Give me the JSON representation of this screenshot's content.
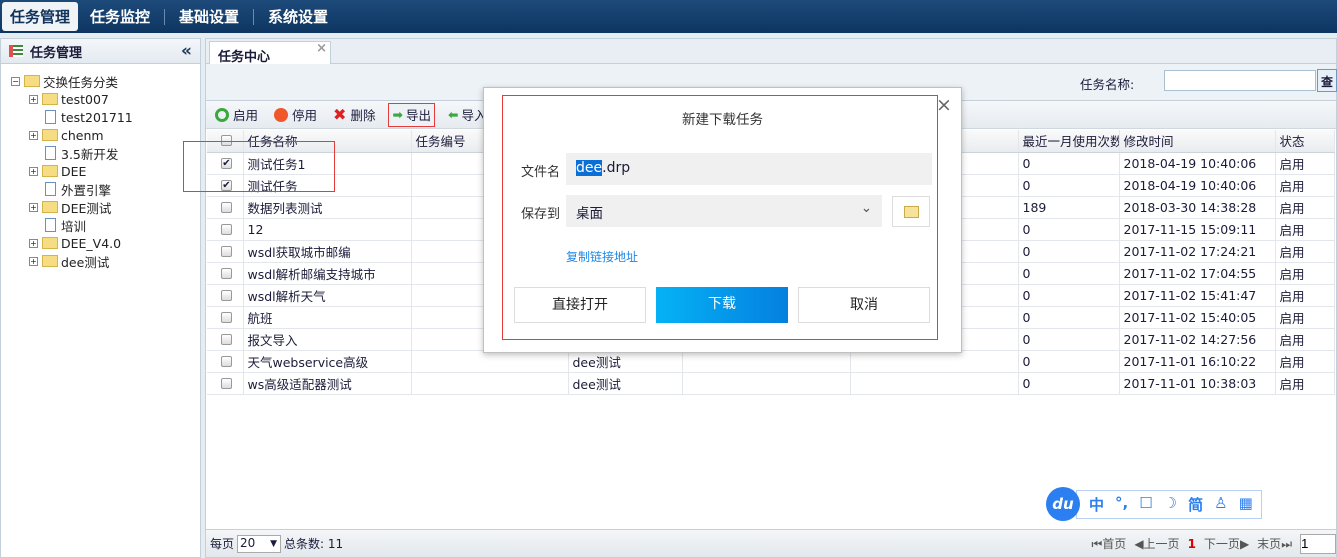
{
  "topnav": [
    "任务管理",
    "任务监控",
    "基础设置",
    "系统设置"
  ],
  "sidebar": {
    "title": "任务管理",
    "collapse": "«",
    "tree": [
      {
        "label": "交换任务分类",
        "type": "root"
      },
      {
        "label": "test007",
        "type": "folder"
      },
      {
        "label": "test201711",
        "type": "file"
      },
      {
        "label": "chenm",
        "type": "folder"
      },
      {
        "label": "3.5新开发",
        "type": "file"
      },
      {
        "label": "DEE",
        "type": "folder"
      },
      {
        "label": "外置引擎",
        "type": "file"
      },
      {
        "label": "DEE测试",
        "type": "folder"
      },
      {
        "label": "培训",
        "type": "file"
      },
      {
        "label": "DEE_V4.0",
        "type": "folder"
      },
      {
        "label": "dee测试",
        "type": "folder"
      }
    ]
  },
  "tab": {
    "label": "任务中心",
    "close": "×"
  },
  "search": {
    "label": "任务名称:",
    "value": "",
    "button": "查"
  },
  "toolbar": {
    "enable": "启用",
    "disable": "停用",
    "delete": "删除",
    "export": "导出",
    "import": "导入"
  },
  "table": {
    "headers": [
      "任务名称",
      "任务编号",
      "",
      "",
      "",
      "最近一月使用次数",
      "修改时间",
      "状态"
    ],
    "rows": [
      {
        "checked": true,
        "name": "测试任务1",
        "group": "",
        "count": "0",
        "time": "2018-04-19 10:40:06",
        "status": "启用"
      },
      {
        "checked": true,
        "name": "测试任务",
        "group": "",
        "count": "0",
        "time": "2018-04-19 10:40:06",
        "status": "启用"
      },
      {
        "checked": false,
        "name": "数据列表测试",
        "group": "",
        "count": "189",
        "time": "2018-03-30 14:38:28",
        "status": "启用"
      },
      {
        "checked": false,
        "name": "12",
        "group": "",
        "count": "0",
        "time": "2017-11-15 15:09:11",
        "status": "启用"
      },
      {
        "checked": false,
        "name": "wsdl获取城市邮编",
        "group": "",
        "count": "0",
        "time": "2017-11-02 17:24:21",
        "status": "启用"
      },
      {
        "checked": false,
        "name": "wsdl解析邮编支持城市",
        "group": "",
        "count": "0",
        "time": "2017-11-02 17:04:55",
        "status": "启用"
      },
      {
        "checked": false,
        "name": "wsdl解析天气",
        "group": "",
        "count": "0",
        "time": "2017-11-02 15:41:47",
        "status": "启用"
      },
      {
        "checked": false,
        "name": "航班",
        "group": "",
        "count": "0",
        "time": "2017-11-02 15:40:05",
        "status": "启用"
      },
      {
        "checked": false,
        "name": "报文导入",
        "group": "",
        "count": "0",
        "time": "2017-11-02 14:27:56",
        "status": "启用"
      },
      {
        "checked": false,
        "name": "天气webservice高级",
        "group": "dee测试",
        "count": "0",
        "time": "2017-11-01 16:10:22",
        "status": "启用"
      },
      {
        "checked": false,
        "name": "ws高级适配器测试",
        "group": "dee测试",
        "count": "0",
        "time": "2017-11-01 10:38:03",
        "status": "启用"
      }
    ]
  },
  "pager": {
    "per_page_label": "每页",
    "per_page": "20",
    "total": "总条数: 11",
    "first": "首页",
    "prev": "上一页",
    "current": "1",
    "next": "下一页",
    "last": "末页",
    "page_input": "1"
  },
  "dialog": {
    "title": "新建下载任务",
    "filename_label": "文件名",
    "filename_selected": "dee",
    "filename_ext": ".drp",
    "saveto_label": "保存到",
    "saveto_value": "桌面",
    "copy_link": "复制链接地址",
    "open": "直接打开",
    "download": "下载",
    "cancel": "取消",
    "close": "×"
  },
  "ime": {
    "logo": "du",
    "items": [
      "中",
      "°,",
      "☐",
      "☽",
      "简",
      "♙",
      "▦"
    ]
  },
  "colors": {
    "accent": "#0a86e0",
    "highlight": "#e43b3b",
    "nav": "#0d3561"
  }
}
